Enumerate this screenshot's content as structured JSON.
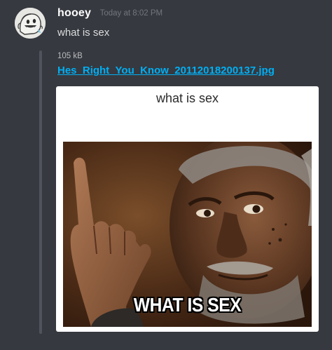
{
  "message": {
    "author": "hooey",
    "timestamp": "Today at 8:02 PM",
    "content": "what is sex"
  },
  "attachment": {
    "file_size": "105 kB",
    "file_name": "Hes_Right_You_Know_20112018200137.jpg",
    "image": {
      "caption_top": "what is sex",
      "caption_bottom": "WHAT IS SEX"
    }
  },
  "colors": {
    "background": "#36393f",
    "link": "#00aff4",
    "embed_bar": "#4f545c",
    "timestamp": "#72767d"
  }
}
